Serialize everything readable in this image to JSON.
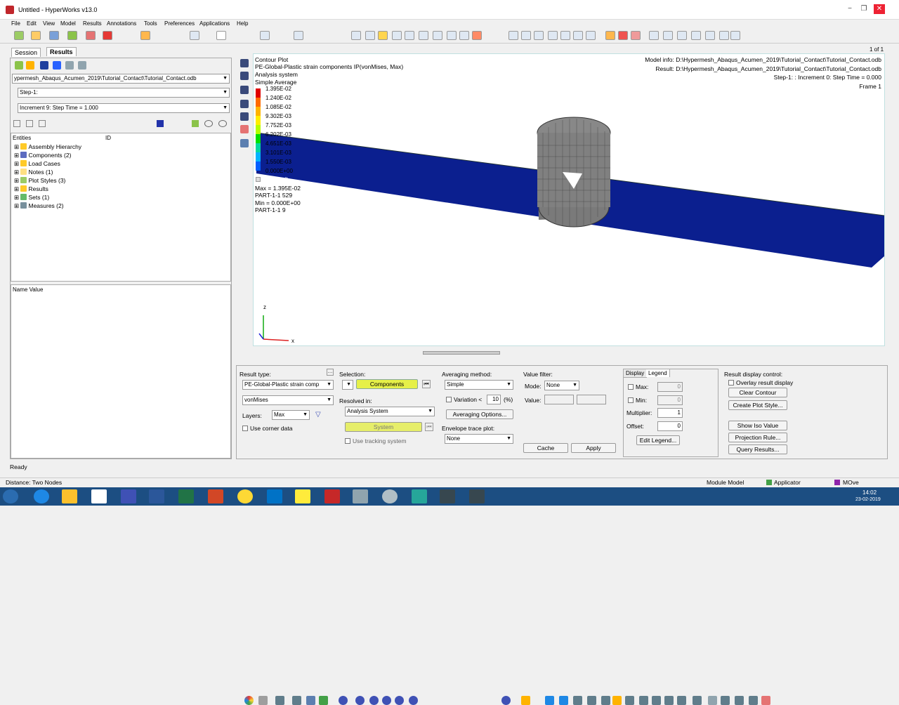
{
  "window": {
    "title": "Untitled - HyperWorks v13.0",
    "min": "−",
    "max": "❐",
    "close": "✕"
  },
  "menu": [
    "File",
    "Edit",
    "View",
    "Model",
    "Results",
    "Annotations",
    "Tools",
    "Preferences",
    "Applications",
    "Help"
  ],
  "left": {
    "tabs": [
      "Session",
      "Results"
    ],
    "file_path": "ypermesh_Abaqus_Acumen_2019\\Tutorial_Contact\\Tutorial_Contact.odb",
    "step": "Step-1:",
    "increment": "Increment    9: Step Time =   1.000",
    "entities_header": "Entities",
    "id_header": "ID",
    "tree": [
      "Assembly Hierarchy",
      "Components (2)",
      "Load Cases",
      "Notes (1)",
      "Plot Styles (3)",
      "Results",
      "Sets  (1)",
      "Measures (2)"
    ],
    "prop_header": "Name Value"
  },
  "viewport": {
    "contour_title": "Contour Plot",
    "result": "PE-Global-Plastic strain components IP(vonMises, Max)",
    "analysis_system": "Analysis system",
    "averaging": "Simple Average",
    "legend_values": [
      "1.395E-02",
      "1.240E-02",
      "1.085E-02",
      "9.302E-03",
      "7.752E-03",
      "6.202E-03",
      "4.651E-03",
      "3.101E-03",
      "1.550E-03",
      "0.000E+00"
    ],
    "legend_colors": [
      "#e00000",
      "#ff6a00",
      "#ffb400",
      "#ffee00",
      "#b4ff00",
      "#00e000",
      "#00d8a0",
      "#00b4ff",
      "#0060ff",
      "#0000c8"
    ],
    "no_result": "No result",
    "max_line": "Max = 1.395E-02",
    "max_part": "PART-1-1 529",
    "min_line": "Min = 0.000E+00",
    "min_part": "PART-1-1 9",
    "model_info": "Model info: D:\\Hypermesh_Abaqus_Acumen_2019\\Tutorial_Contact\\Tutorial_Contact.odb",
    "result_info": "Result: D:\\Hypermesh_Abaqus_Acumen_2019\\Tutorial_Contact\\Tutorial_Contact.odb",
    "step_info": "Step-1:  : Increment      0: Step Time =    0.000",
    "frame": "Frame 1",
    "page": "1 of 1",
    "axis_z": "z",
    "axis_x": "x"
  },
  "bottom": {
    "result_type_label": "Result type:",
    "result_type": "PE-Global-Plastic strain comp",
    "component": "vonMises",
    "layers_label": "Layers:",
    "layers": "Max",
    "use_corner": "Use corner data",
    "selection_label": "Selection:",
    "components_btn": "Components",
    "resolved_label": "Resolved in:",
    "resolved": "Analysis System",
    "system_btn": "System",
    "use_tracking": "Use tracking system",
    "avg_label": "Averaging method:",
    "avg": "Simple",
    "variation_label": "Variation <",
    "variation_val": "10",
    "variation_unit": "(%)",
    "avg_options": "Averaging Options...",
    "envelope_label": "Envelope trace plot:",
    "envelope": "None",
    "value_filter": "Value filter:",
    "mode_label": "Mode:",
    "mode": "None",
    "value_label": "Value:",
    "cache": "Cache",
    "apply": "Apply",
    "display_tab": "Display",
    "legend_tab": "Legend",
    "max_label": "Max:",
    "max_val": "0",
    "min_label": "Min:",
    "min_val": "0",
    "multiplier_label": "Multiplier:",
    "multiplier_val": "1",
    "offset_label": "Offset:",
    "offset_val": "0",
    "edit_legend": "Edit Legend...",
    "rdc_label": "Result display control:",
    "overlay": "Overlay result display",
    "clear_contour": "Clear Contour",
    "create_plot_style": "Create Plot Style...",
    "show_iso": "Show Iso Value",
    "projection": "Projection Rule...",
    "query": "Query Results..."
  },
  "status": {
    "ready": "Ready",
    "distance": "Distance: Two Nodes",
    "module": "Module Model",
    "application": "Applicator",
    "move": "MOve"
  },
  "clock": {
    "time": "14:02",
    "date": "23-02-2019"
  }
}
